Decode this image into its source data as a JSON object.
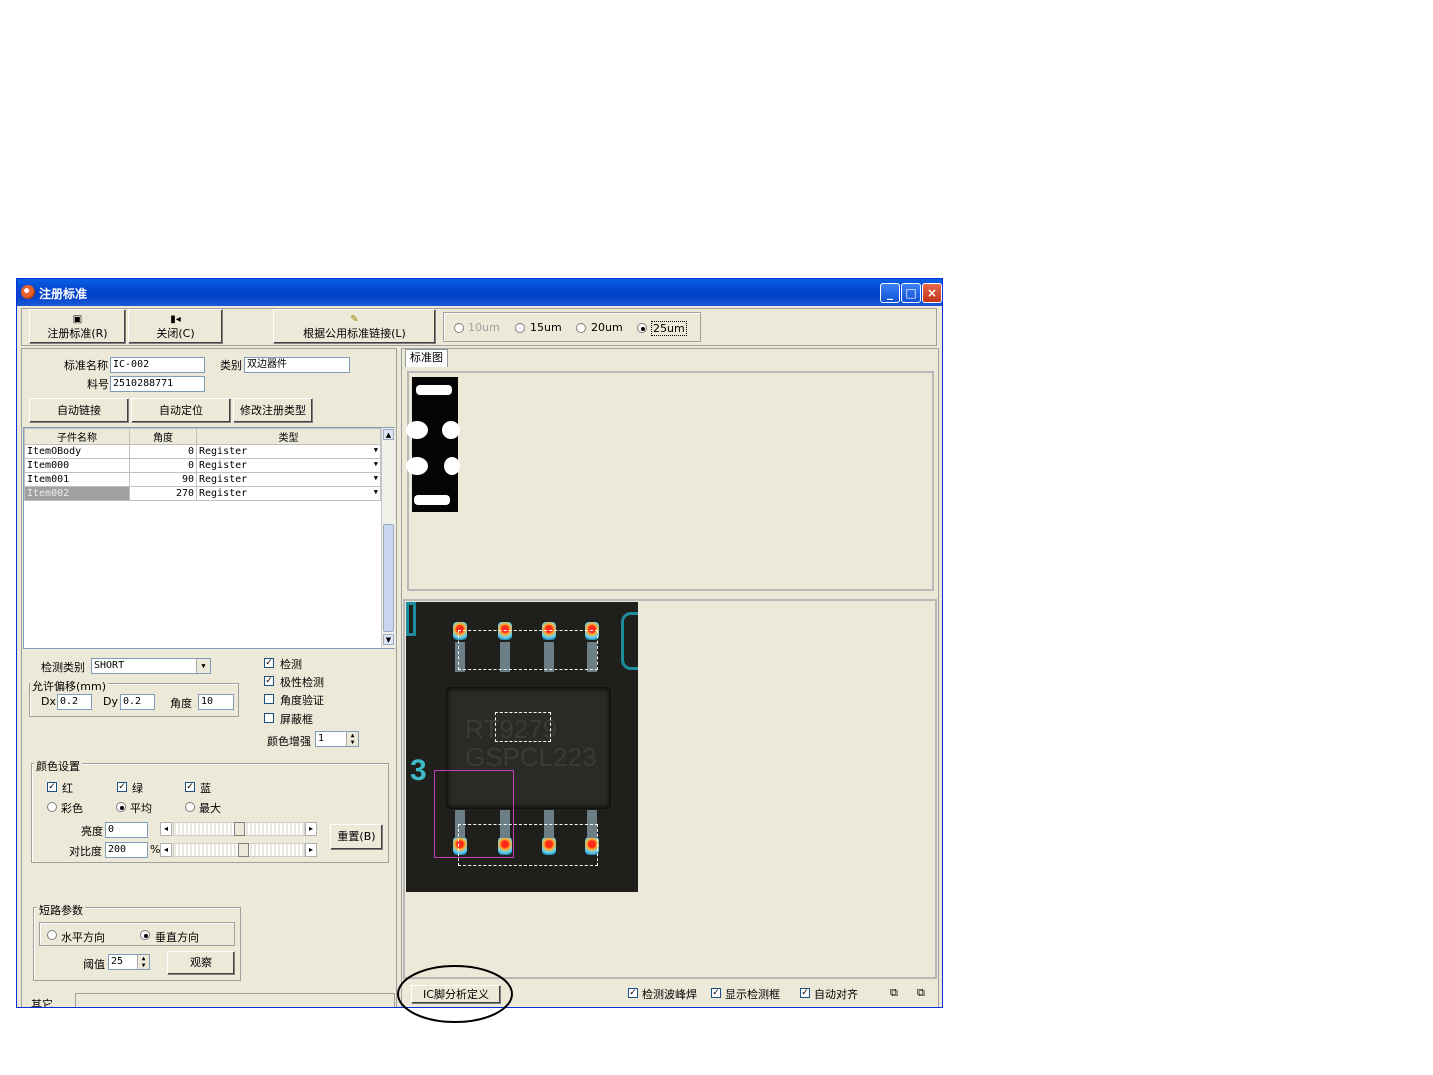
{
  "window": {
    "title": "注册标准"
  },
  "toolbar": {
    "register_label": "注册标准(R)",
    "close_label": "关闭(C)",
    "link_label": "根据公用标准链接(L)",
    "radios": [
      {
        "label": "10um",
        "selected": false,
        "enabled": false
      },
      {
        "label": "15um",
        "selected": false,
        "enabled": true
      },
      {
        "label": "20um",
        "selected": false,
        "enabled": true
      },
      {
        "label": "25um",
        "selected": true,
        "enabled": true
      }
    ]
  },
  "form": {
    "name_label": "标准名称",
    "name_value": "IC-002",
    "category_label": "类别",
    "category_value": "双边器件",
    "part_label": "料号",
    "part_value": "2510288771",
    "auto_link": "自动链接",
    "auto_locate": "自动定位",
    "modify_type": "修改注册类型"
  },
  "table": {
    "headers": [
      "子件名称",
      "角度",
      "类型"
    ],
    "rows": [
      {
        "name": "ItemOBody",
        "angle": "0",
        "type": "Register"
      },
      {
        "name": "Item000",
        "angle": "0",
        "type": "Register"
      },
      {
        "name": "Item001",
        "angle": "90",
        "type": "Register"
      },
      {
        "name": "Item002",
        "angle": "270",
        "type": "Register"
      }
    ]
  },
  "detect": {
    "type_label": "检测类别",
    "type_value": "SHORT",
    "offset_group": "允许偏移(mm)",
    "dx_label": "Dx",
    "dx_value": "0.2",
    "dy_label": "Dy",
    "dy_value": "0.2",
    "angle_label": "角度",
    "angle_value": "10",
    "checks": [
      {
        "label": "检测",
        "checked": true
      },
      {
        "label": "极性检测",
        "checked": true
      },
      {
        "label": "角度验证",
        "checked": false
      },
      {
        "label": "屏蔽框",
        "checked": false
      }
    ],
    "color_gain_label": "颜色增强",
    "color_gain_value": "1"
  },
  "color": {
    "group": "颜色设置",
    "red": "红",
    "green": "绿",
    "blue": "蓝",
    "mode_color": "彩色",
    "mode_avg": "平均",
    "mode_max": "最大",
    "brightness_label": "亮度",
    "brightness_value": "0",
    "contrast_label": "对比度",
    "contrast_value": "200",
    "percent": "%",
    "reset_label": "重置(B)"
  },
  "short": {
    "group": "短路参数",
    "horizontal": "水平方向",
    "vertical": "垂直方向",
    "threshold_label": "阈值",
    "threshold_value": "25",
    "observe_label": "观察"
  },
  "other": {
    "label": "其它"
  },
  "right": {
    "tab_label": "标准图",
    "chip_marking_1": "RT9279",
    "chip_marking_2": "GSPCL223",
    "board_number": "3"
  },
  "bottom": {
    "ic_button": "IC脚分析定义",
    "check_wave": "检测波峰焊",
    "check_show": "显示检测框",
    "check_align": "自动对齐"
  }
}
